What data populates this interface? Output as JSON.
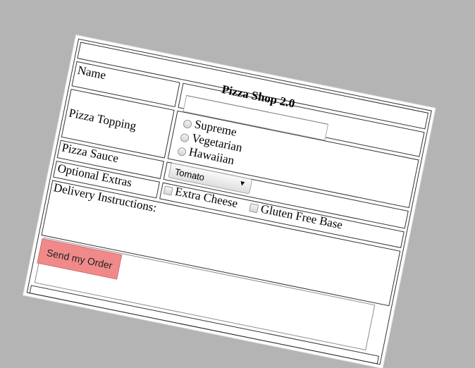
{
  "form": {
    "title": "Pizza Shop 2.0",
    "name_label": "Name",
    "name_value": "",
    "topping_label": "Pizza Topping",
    "toppings": [
      "Supreme",
      "Vegetarian",
      "Hawaiian"
    ],
    "sauce_label": "Pizza Sauce",
    "sauce_selected": "Tomato",
    "extras_label": "Optional Extras",
    "extras": [
      "Extra Cheese",
      "Gluten Free Base"
    ],
    "delivery_label": "Delivery Instructions:",
    "delivery_value": "",
    "submit_label": "Send my Order"
  },
  "colors": {
    "background": "#b4b4b4",
    "submit_button": "#f08a8a",
    "card": "#ffffff"
  }
}
